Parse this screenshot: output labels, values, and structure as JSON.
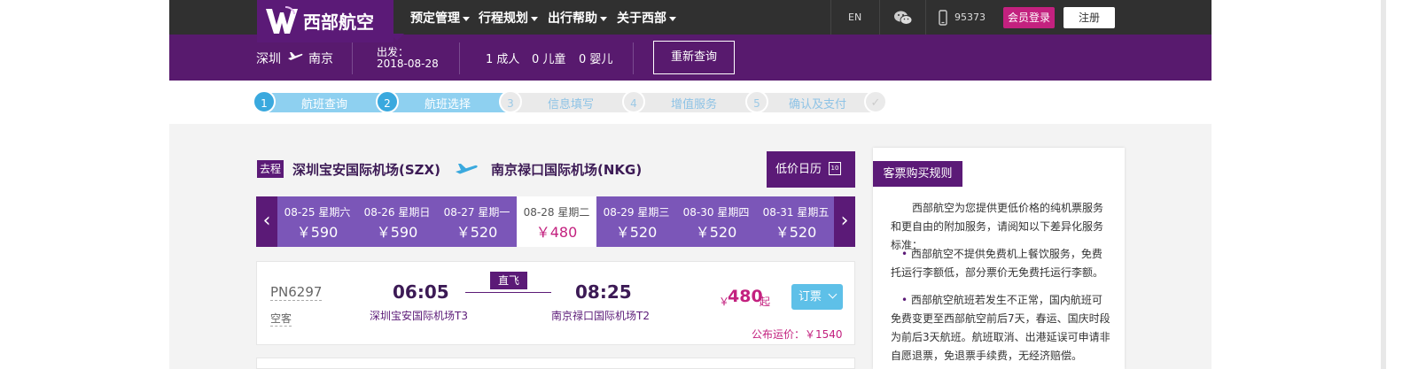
{
  "nav": {
    "logo_text": "西部航空",
    "items": [
      {
        "label": "预定管理"
      },
      {
        "label": "行程规划"
      },
      {
        "label": "出行帮助"
      },
      {
        "label": "关于西部"
      }
    ],
    "lang": "EN",
    "wechat_icon": "wechat-icon",
    "phone_icon": "phone-icon",
    "phone_number": "95373",
    "member_login": "会员登录",
    "register": "注册"
  },
  "search": {
    "origin": "深圳",
    "destination": "南京",
    "depart_label": "出发：",
    "depart_date": "2018-08-28",
    "adults": "1 成人",
    "children": "0 儿童",
    "infants": "0 婴儿",
    "requery": "重新查询"
  },
  "steps": [
    {
      "num": "1",
      "label": "航班查询"
    },
    {
      "num": "2",
      "label": "航班选择"
    },
    {
      "num": "3",
      "label": "信息填写"
    },
    {
      "num": "4",
      "label": "增值服务"
    },
    {
      "num": "5",
      "label": "确认及支付"
    }
  ],
  "route": {
    "direction_tag": "去程",
    "from_airport": "深圳宝安国际机场(SZX)",
    "to_airport": "南京禄口国际机场(NKG)",
    "calendar_button": "低价日历",
    "calendar_icon_day": "10"
  },
  "dates": [
    {
      "date": "08-25 星期六",
      "price": "￥590"
    },
    {
      "date": "08-26 星期日",
      "price": "￥590"
    },
    {
      "date": "08-27 星期一",
      "price": "￥520"
    },
    {
      "date": "08-28 星期二",
      "price": "￥480",
      "selected": true
    },
    {
      "date": "08-29 星期三",
      "price": "￥520"
    },
    {
      "date": "08-30 星期四",
      "price": "￥520"
    },
    {
      "date": "08-31 星期五",
      "price": "￥520"
    }
  ],
  "flight": {
    "number": "PN6297",
    "aircraft": "空客",
    "depart_time": "06:05",
    "arrive_time": "08:25",
    "depart_airport": "深圳宝安国际机场T3",
    "arrive_airport": "南京禄口国际机场T2",
    "direct": "直飞",
    "price_currency": "￥",
    "price": "480",
    "price_suffix": "起",
    "book": "订票",
    "published_fare": "公布运价：￥1540"
  },
  "rules": {
    "title": "客票购买规则",
    "intro": "西部航空为您提供更低价格的纯机票服务和更自由的附加服务，请阅知以下差异化服务标准：",
    "item1": "西部航空不提供免费机上餐饮服务，免费托运行李额低，部分票价无免费托运行李额。",
    "item2": "西部航空航班若发生不正常，国内航班可免费变更至西部航空前后7天，春运、国庆时段为前后3天航班。航班取消、出港延误可申请非自愿退票，免退票手续费，无经济赔偿。"
  },
  "colors": {
    "brand_purple": "#5b1a77",
    "date_strip": "#7b56b8",
    "accent_pink": "#c3217f",
    "step_active": "#3aa9de",
    "book_button": "#5ec0e8"
  }
}
